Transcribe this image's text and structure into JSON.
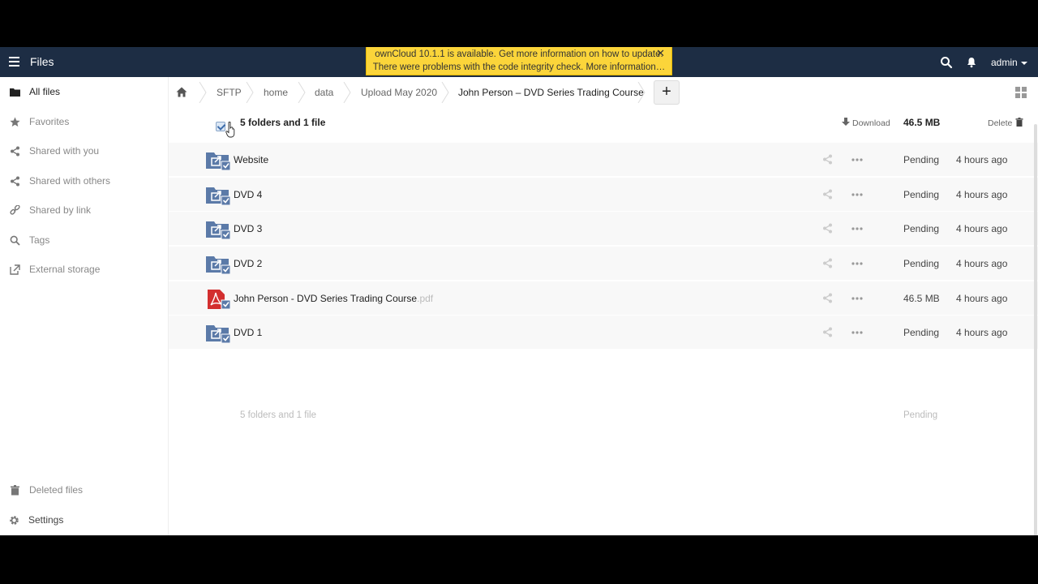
{
  "header": {
    "app_title": "Files",
    "user": "admin"
  },
  "notification": {
    "line1": "ownCloud 10.1.1 is available. Get more information on how to update.",
    "line2": "There were problems with the code integrity check. More information…",
    "close_symbol": "✕"
  },
  "sidebar": {
    "items": [
      {
        "label": "All files",
        "icon": "folder-icon"
      },
      {
        "label": "Favorites",
        "icon": "star-icon"
      },
      {
        "label": "Shared with you",
        "icon": "share-icon"
      },
      {
        "label": "Shared with others",
        "icon": "share-icon"
      },
      {
        "label": "Shared by link",
        "icon": "link-icon"
      },
      {
        "label": "Tags",
        "icon": "search-icon"
      },
      {
        "label": "External storage",
        "icon": "external-link-icon"
      }
    ],
    "bottom": [
      {
        "label": "Deleted files",
        "icon": "trash-icon"
      },
      {
        "label": "Settings",
        "icon": "gear-icon"
      }
    ]
  },
  "breadcrumbs": {
    "home_icon": "home-icon",
    "items": [
      "SFTP",
      "home",
      "data",
      "Upload May 2020",
      "John Person – DVD Series Trading Course"
    ],
    "new_button": "+"
  },
  "table": {
    "header": {
      "summary": "5 folders and 1 file",
      "download": "Download",
      "size": "46.5 MB",
      "delete": "Delete"
    },
    "rows": [
      {
        "name": "Website",
        "ext": "",
        "type": "folder",
        "size": "Pending",
        "modified": "4 hours ago"
      },
      {
        "name": "DVD 4",
        "ext": "",
        "type": "folder",
        "size": "Pending",
        "modified": "4 hours ago"
      },
      {
        "name": "DVD 3",
        "ext": "",
        "type": "folder",
        "size": "Pending",
        "modified": "4 hours ago"
      },
      {
        "name": "DVD 2",
        "ext": "",
        "type": "folder",
        "size": "Pending",
        "modified": "4 hours ago"
      },
      {
        "name": "John Person - DVD Series Trading Course",
        "ext": ".pdf",
        "type": "pdf",
        "size": "46.5 MB",
        "modified": "4 hours ago"
      },
      {
        "name": "DVD 1",
        "ext": "",
        "type": "folder",
        "size": "Pending",
        "modified": "4 hours ago"
      }
    ],
    "footer": {
      "summary": "5 folders and 1 file",
      "size": "Pending"
    }
  },
  "colors": {
    "header_bg": "#1d2d44",
    "notice_bg": "#fbd53a",
    "folder": "#5b7aa8",
    "pdf": "#d32f2f"
  }
}
